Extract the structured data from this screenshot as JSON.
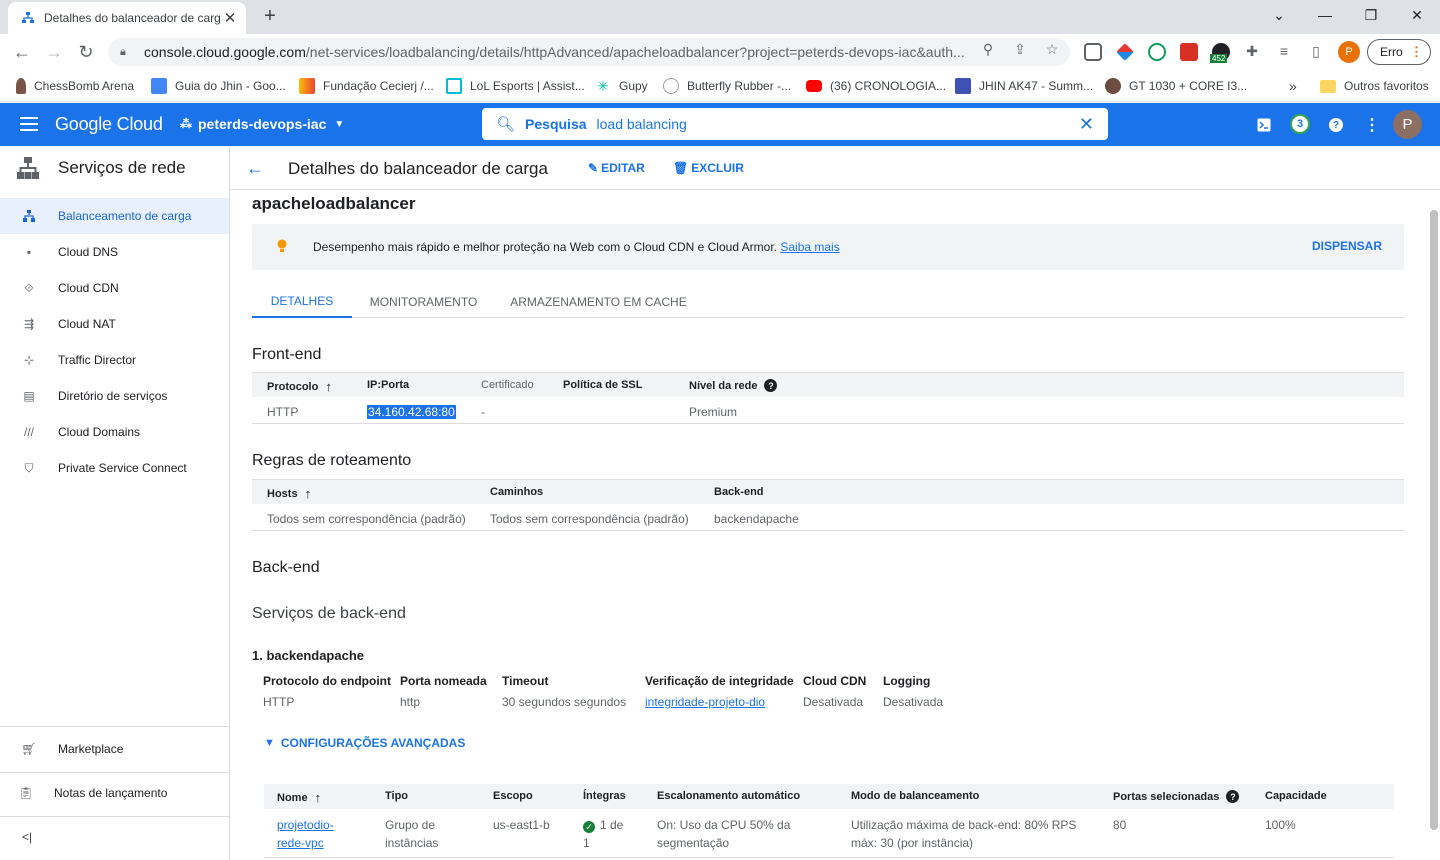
{
  "browser": {
    "tab_title": "Detalhes do balanceador de carg",
    "url_main": "console.cloud.google.com",
    "url_rest": "/net-services/loadbalancing/details/httpAdvanced/apacheloadbalancer?project=peterds-devops-iac&auth...",
    "profile_initial": "P",
    "error_label": "Erro",
    "bookmarks": [
      "ChessBomb Arena",
      "Guia do Jhin - Goo...",
      "Fundação Cecierj /...",
      "LoL Esports | Assist...",
      "Gupy",
      "Butterfly Rubber -...",
      "(36) CRONOLOGIA...",
      "JHIN AK47 - Summ...",
      "GT 1030 + CORE I3...",
      "Outros favoritos"
    ],
    "ext_badge": "452"
  },
  "gcp": {
    "logo": "Google Cloud",
    "project": "peterds-devops-iac",
    "search_label": "Pesquisa",
    "search_value": "load balancing",
    "notif_count": "3",
    "avatar": "P"
  },
  "sidebar": {
    "title": "Serviços de rede",
    "items": [
      "Balanceamento de carga",
      "Cloud DNS",
      "Cloud CDN",
      "Cloud NAT",
      "Traffic Director",
      "Diretório de serviços",
      "Cloud Domains",
      "Private Service Connect"
    ],
    "marketplace": "Marketplace",
    "release_notes": "Notas de lançamento",
    "collapse": "<|"
  },
  "page": {
    "title": "Detalhes do balanceador de carga",
    "edit": "EDITAR",
    "delete": "EXCLUIR",
    "lb_name": "apacheloadbalancer",
    "banner_text": "Desempenho mais rápido e melhor proteção na Web com o Cloud CDN e Cloud Armor.",
    "banner_link": "Saiba mais",
    "banner_dismiss": "DISPENSAR",
    "tabs": [
      "DETALHES",
      "MONITORAMENTO",
      "ARMAZENAMENTO EM CACHE"
    ]
  },
  "frontend": {
    "title": "Front-end",
    "headers": [
      "Protocolo",
      "IP:Porta",
      "Certificado",
      "Política de SSL",
      "Nível da rede"
    ],
    "row": [
      "HTTP",
      "34.160.42.68:80",
      "-",
      "",
      "Premium"
    ]
  },
  "routing": {
    "title": "Regras de roteamento",
    "headers": [
      "Hosts",
      "Caminhos",
      "Back-end"
    ],
    "row": [
      "Todos sem correspondência (padrão)",
      "Todos sem correspondência (padrão)",
      "backendapache"
    ]
  },
  "backend": {
    "title": "Back-end",
    "services_title": "Serviços de back-end",
    "service_name": "1. backendapache",
    "headers": [
      "Protocolo do endpoint",
      "Porta nomeada",
      "Timeout",
      "Verificação de integridade",
      "Cloud CDN",
      "Logging"
    ],
    "values": [
      "HTTP",
      "http",
      "30 segundos segundos",
      "integridade-projeto-dio",
      "Desativada",
      "Desativada"
    ],
    "advanced": "CONFIGURAÇÕES AVANÇADAS",
    "table_headers": [
      "Nome",
      "Tipo",
      "Escopo",
      "Íntegras",
      "Escalonamento automático",
      "Modo de balanceamento",
      "Portas selecionadas",
      "Capacidade"
    ],
    "table_row": {
      "name_1": "projetodio-",
      "name_2": "rede-vpc",
      "type_1": "Grupo de",
      "type_2": "instâncias",
      "scope": "us-east1-b",
      "healthy_1": "1 de",
      "healthy_2": "1",
      "autoscale_1": "On: Uso da CPU 50% da",
      "autoscale_2": "segmentação",
      "mode_1": "Utilização máxima de back-end: 80% RPS",
      "mode_2": "máx: 30 (por instância)",
      "ports": "80",
      "capacity": "100%"
    }
  }
}
